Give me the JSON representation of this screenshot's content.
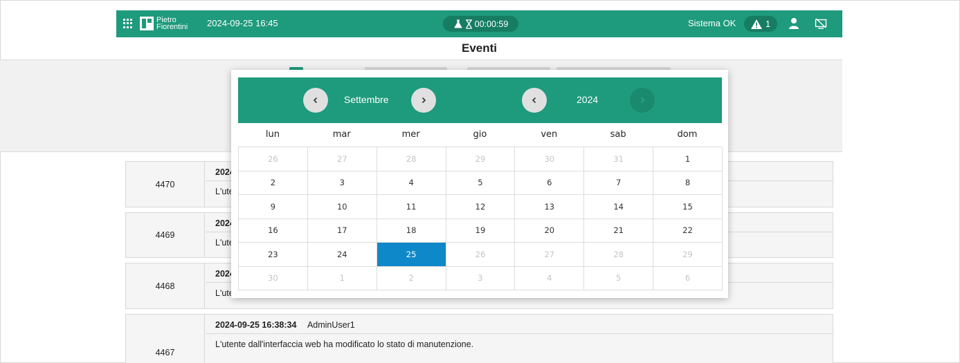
{
  "header": {
    "logo_line1": "Pietro",
    "logo_line2": "Fiorentini",
    "datetime": "2024-09-25 16:45",
    "timer": "00:00:59",
    "status": "Sistema OK",
    "alert_count": "1"
  },
  "page": {
    "title": "Eventi"
  },
  "events": [
    {
      "id": "4470",
      "timestamp": "2024",
      "user": "",
      "message": "L'ute"
    },
    {
      "id": "4469",
      "timestamp": "2024",
      "user": "",
      "message": "L'ute"
    },
    {
      "id": "4468",
      "timestamp": "2024",
      "user": "",
      "message": "L'utente dall'interfaccia web ha effettuato l'accesso."
    },
    {
      "id": "4467",
      "timestamp": "2024-09-25 16:38:34",
      "user": "AdminUser1",
      "message": "L'utente dall'interfaccia web ha modificato lo stato di manutenzione."
    }
  ],
  "calendar": {
    "month": "Settembre",
    "year": "2024",
    "weekdays": [
      "lun",
      "mar",
      "mer",
      "gio",
      "ven",
      "sab",
      "dom"
    ],
    "days": [
      {
        "d": "26",
        "muted": true
      },
      {
        "d": "27",
        "muted": true
      },
      {
        "d": "28",
        "muted": true
      },
      {
        "d": "29",
        "muted": true
      },
      {
        "d": "30",
        "muted": true
      },
      {
        "d": "31",
        "muted": true
      },
      {
        "d": "1"
      },
      {
        "d": "2"
      },
      {
        "d": "3"
      },
      {
        "d": "4"
      },
      {
        "d": "5"
      },
      {
        "d": "6"
      },
      {
        "d": "7"
      },
      {
        "d": "8"
      },
      {
        "d": "9"
      },
      {
        "d": "10"
      },
      {
        "d": "11"
      },
      {
        "d": "12"
      },
      {
        "d": "13"
      },
      {
        "d": "14"
      },
      {
        "d": "15"
      },
      {
        "d": "16"
      },
      {
        "d": "17"
      },
      {
        "d": "18"
      },
      {
        "d": "19"
      },
      {
        "d": "20"
      },
      {
        "d": "21"
      },
      {
        "d": "22"
      },
      {
        "d": "23"
      },
      {
        "d": "24"
      },
      {
        "d": "25",
        "selected": true
      },
      {
        "d": "26",
        "muted": true
      },
      {
        "d": "27",
        "muted": true
      },
      {
        "d": "28",
        "muted": true
      },
      {
        "d": "29",
        "muted": true
      },
      {
        "d": "30",
        "muted": true
      },
      {
        "d": "1",
        "muted": true
      },
      {
        "d": "2",
        "muted": true
      },
      {
        "d": "3",
        "muted": true
      },
      {
        "d": "4",
        "muted": true
      },
      {
        "d": "5",
        "muted": true
      },
      {
        "d": "6",
        "muted": true
      }
    ]
  },
  "colors": {
    "brand_green": "#1e9a7c",
    "selected_blue": "#0f88c9"
  },
  "icons": {
    "apps": "grid-icon",
    "timer": "flask-hourglass-icon",
    "alert": "warning-icon",
    "user": "user-icon",
    "display": "screen-off-icon",
    "prev": "chevron-left-icon",
    "next": "chevron-right-icon"
  }
}
